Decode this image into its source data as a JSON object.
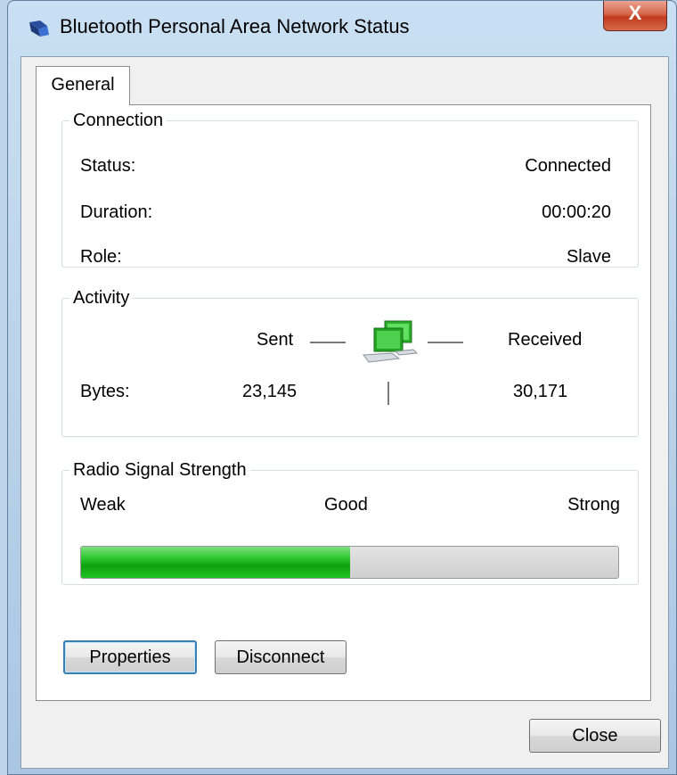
{
  "window": {
    "title": "Bluetooth Personal Area Network Status",
    "close_glyph": "X",
    "icon": "bluetooth-network-icon"
  },
  "tabs": [
    {
      "label": "General",
      "selected": true
    }
  ],
  "connection": {
    "legend": "Connection",
    "rows": [
      {
        "label": "Status:",
        "value": "Connected"
      },
      {
        "label": "Duration:",
        "value": "00:00:20"
      },
      {
        "label": "Role:",
        "value": "Slave"
      }
    ]
  },
  "activity": {
    "legend": "Activity",
    "sent_label": "Sent",
    "received_label": "Received",
    "bytes_label": "Bytes:",
    "bytes_sent": "23,145",
    "bytes_received": "30,171",
    "icon": "network-computers-icon"
  },
  "signal": {
    "legend": "Radio Signal Strength",
    "weak_label": "Weak",
    "good_label": "Good",
    "strong_label": "Strong",
    "level_fraction": 0.5,
    "fill_color": "#1fb522"
  },
  "buttons": {
    "properties": "Properties",
    "disconnect": "Disconnect",
    "close": "Close"
  }
}
